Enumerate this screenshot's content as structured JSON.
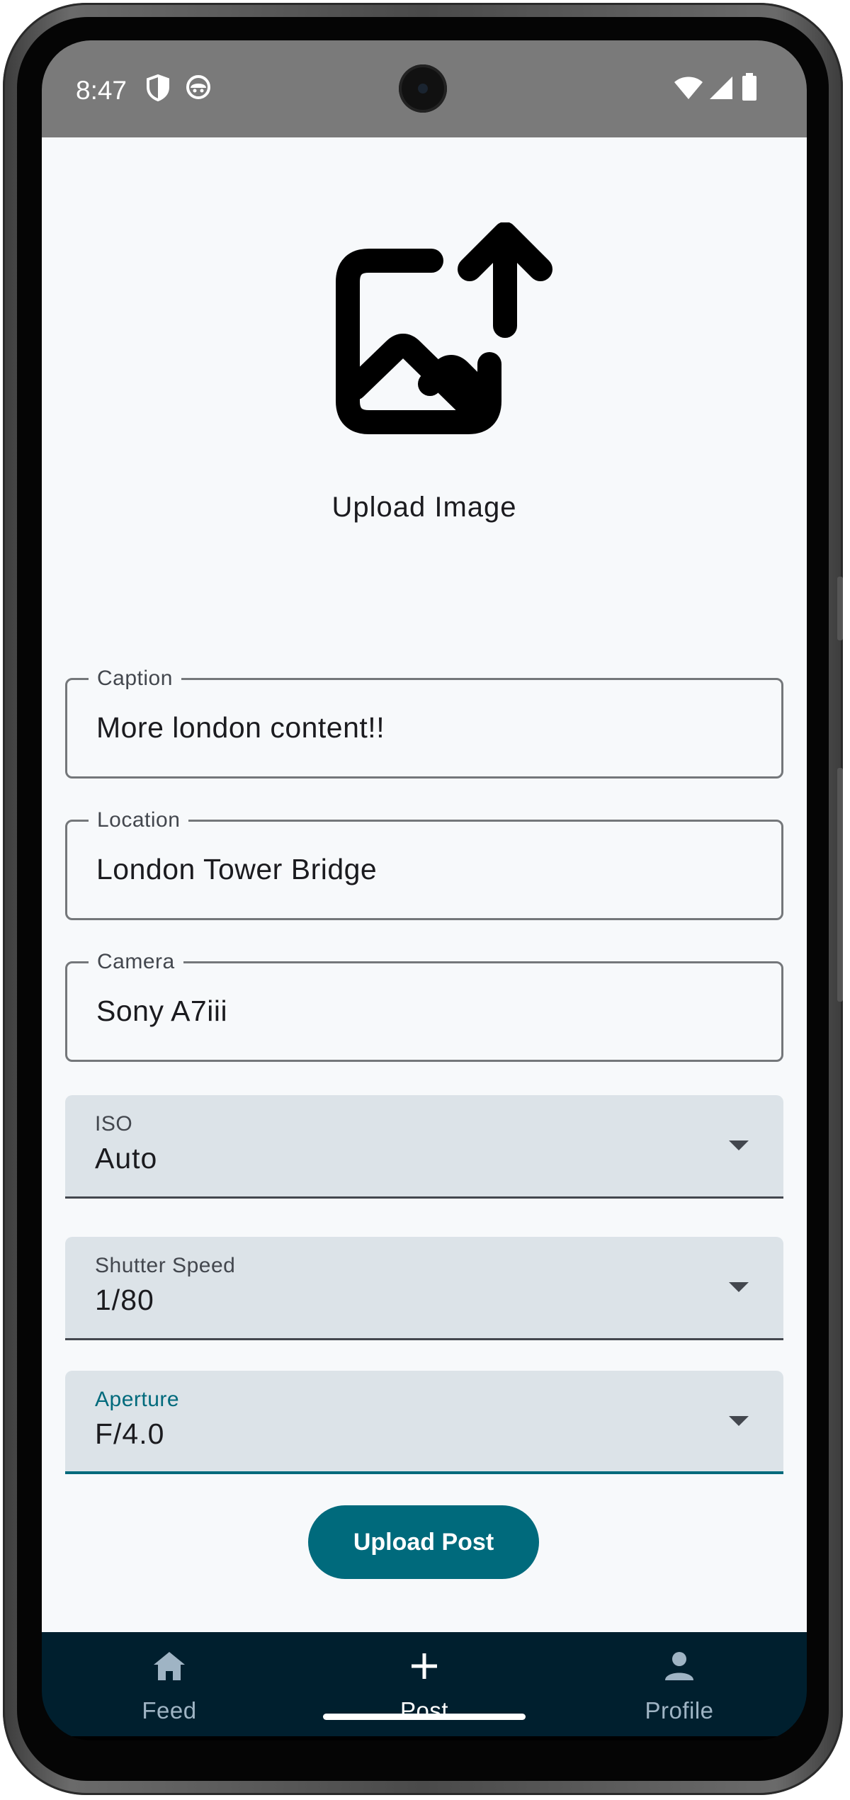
{
  "status_bar": {
    "time": "8:47",
    "left_icons": [
      "shield-icon",
      "android-face-icon"
    ],
    "right_icons": [
      "wifi-icon",
      "cellular-signal-icon",
      "battery-icon"
    ]
  },
  "upload": {
    "icon": "image-upload-icon",
    "label": "Upload Image"
  },
  "form": {
    "caption": {
      "label": "Caption",
      "value": "More london content!!"
    },
    "location": {
      "label": "Location",
      "value": "London Tower Bridge"
    },
    "camera": {
      "label": "Camera",
      "value": "Sony A7iii"
    },
    "iso": {
      "label": "ISO",
      "value": "Auto"
    },
    "shutter_speed": {
      "label": "Shutter Speed",
      "value": "1/80"
    },
    "aperture": {
      "label": "Aperture",
      "value": "F/4.0"
    }
  },
  "submit_button": {
    "label": "Upload Post"
  },
  "bottom_nav": {
    "items": [
      {
        "label": "Feed",
        "icon": "home-icon",
        "selected": false
      },
      {
        "label": "Post",
        "icon": "plus-icon",
        "selected": true
      },
      {
        "label": "Profile",
        "icon": "person-icon",
        "selected": false
      }
    ]
  },
  "colors": {
    "primary": "#006a7c",
    "nav_background": "#001f2e",
    "status_bar": "#7a7a7a",
    "field_fill": "#dce3e8",
    "nav_inactive": "#9fb4c4"
  }
}
